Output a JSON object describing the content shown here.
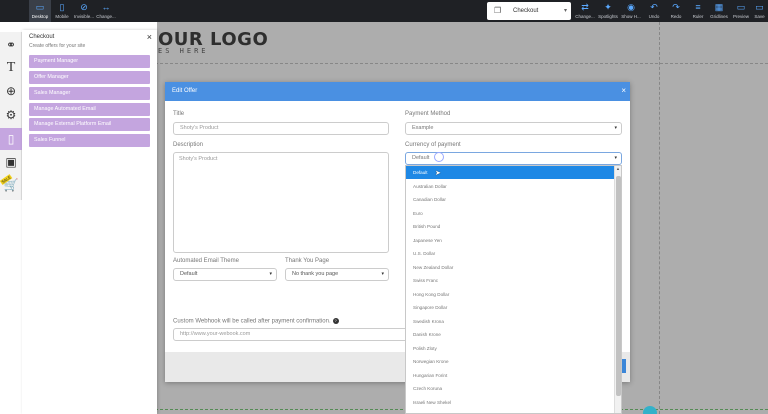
{
  "toolbar": {
    "left": [
      {
        "label": "Desktop",
        "icon": "desktop-icon",
        "glyph": "▭"
      },
      {
        "label": "Mobile",
        "icon": "mobile-icon",
        "glyph": "▯"
      },
      {
        "label": "Invisible...",
        "icon": "invisible-icon",
        "glyph": "⊘"
      },
      {
        "label": "Change...",
        "icon": "resize-icon",
        "glyph": "↔"
      }
    ],
    "page_selector": {
      "label": "Checkout",
      "icon": "pages-icon"
    },
    "right": [
      {
        "label": "Change...",
        "icon": "change-icon",
        "glyph": "⇄"
      },
      {
        "label": "Spotlights",
        "icon": "spotlight-icon",
        "glyph": "✦"
      },
      {
        "label": "Show H...",
        "icon": "show-hidden-icon",
        "glyph": "◉"
      },
      {
        "label": "Undo",
        "icon": "undo-icon",
        "glyph": "↶"
      },
      {
        "label": "Redo",
        "icon": "redo-icon",
        "glyph": "↷"
      },
      {
        "label": "Ruler",
        "icon": "ruler-icon",
        "glyph": "≡"
      },
      {
        "label": "Gridlines",
        "icon": "gridlines-icon",
        "glyph": "▦"
      },
      {
        "label": "Preview",
        "icon": "preview-icon",
        "glyph": "▭"
      },
      {
        "label": "Save",
        "icon": "save-icon",
        "glyph": "▭"
      }
    ]
  },
  "canvas": {
    "logo": "OUR LOGO",
    "logo_sub": "ES HERE"
  },
  "checkout_panel": {
    "title": "Checkout",
    "subtitle": "Create offers for your site",
    "close": "×",
    "items": [
      "Payment Manager",
      "Offer Manager",
      "Sales Manager",
      "Manage Automated Email",
      "Manage External Platform Email",
      "Sales Funnel"
    ]
  },
  "edit_offer": {
    "title": "Edit Offer",
    "close": "×",
    "title_label": "Title",
    "title_value": "Shoty's Product",
    "description_label": "Description",
    "description_value": "Shoty's Product",
    "email_theme_label": "Automated Email Theme",
    "email_theme_value": "Default",
    "thank_you_label": "Thank You Page",
    "thank_you_value": "No thank you page",
    "webhook_label": "Custom Webhook will be called after payment confirmation.",
    "webhook_placeholder": "http://www.your-webook.com",
    "payment_method_label": "Payment Method",
    "payment_method_value": "Example",
    "currency_label": "Currency of payment",
    "currency_value": "Default"
  },
  "currency_options": [
    "Default",
    "Australian Dollar",
    "Canadian Dollar",
    "Euro",
    "British Pound",
    "Japanese Yen",
    "U.S. Dollar",
    "New Zealand Dollar",
    "Swiss Franc",
    "Hong Kong Dollar",
    "Singapore Dollar",
    "Swedish Krona",
    "Danish Krone",
    "Polish Zloty",
    "Norwegian Krone",
    "Hungarian Forint",
    "Czech Koruna",
    "Israeli New Shekel"
  ],
  "currency_selected_index": 0,
  "colors": {
    "toolbar_bg": "#1f2125",
    "accent": "#4a90e2",
    "panel_item": "#c4a5df",
    "dropdown_selected": "#1e88e5"
  }
}
